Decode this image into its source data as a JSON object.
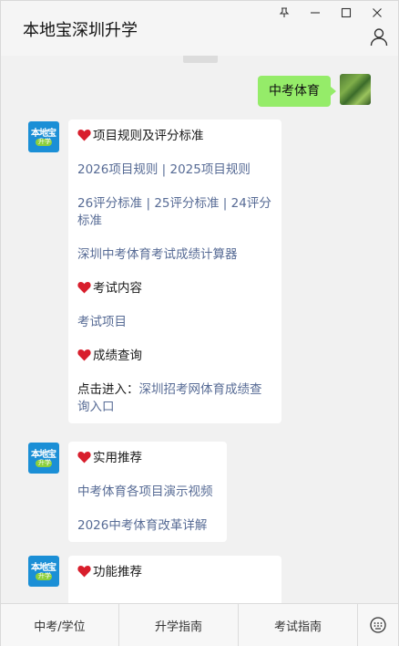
{
  "window": {
    "title": "本地宝深圳升学",
    "controls": [
      "pin-icon",
      "minimize-icon",
      "maximize-icon",
      "close-icon"
    ]
  },
  "chat": {
    "user_message": "中考体育",
    "bot_avatar": {
      "top": "本地宝",
      "pill": "升学"
    },
    "messages": [
      {
        "lines": [
          {
            "type": "heading",
            "text": "项目规则及评分标准"
          },
          {
            "type": "links",
            "items": [
              "2026项目规则",
              "2025项目规则"
            ],
            "sep": " | "
          },
          {
            "type": "links",
            "items": [
              "26评分标准",
              "25评分标准",
              "24评分标准"
            ],
            "sep": " | "
          },
          {
            "type": "link",
            "text": "深圳中考体育考试成绩计算器"
          },
          {
            "type": "heading",
            "text": "考试内容"
          },
          {
            "type": "link",
            "text": "考试项目"
          },
          {
            "type": "heading",
            "text": "成绩查询"
          },
          {
            "type": "mixed",
            "prefix": "点击进入：",
            "link": "深圳招考网体育成绩查询入口"
          }
        ]
      },
      {
        "lines": [
          {
            "type": "heading",
            "text": "实用推荐"
          },
          {
            "type": "link",
            "text": "中考体育各项目演示视频"
          },
          {
            "type": "link",
            "text": "2026中考体育改革详解"
          }
        ]
      },
      {
        "lines": [
          {
            "type": "heading",
            "text": "功能推荐"
          }
        ]
      }
    ]
  },
  "bottom_menu": {
    "items": [
      "中考/学位",
      "升学指南",
      "考试指南"
    ],
    "keyboard_icon": "keyboard-icon"
  },
  "colors": {
    "link": "#576b95",
    "user_bubble": "#95ec69",
    "heart": "#d81e2c",
    "avatar_blue": "#1b8fd6"
  }
}
